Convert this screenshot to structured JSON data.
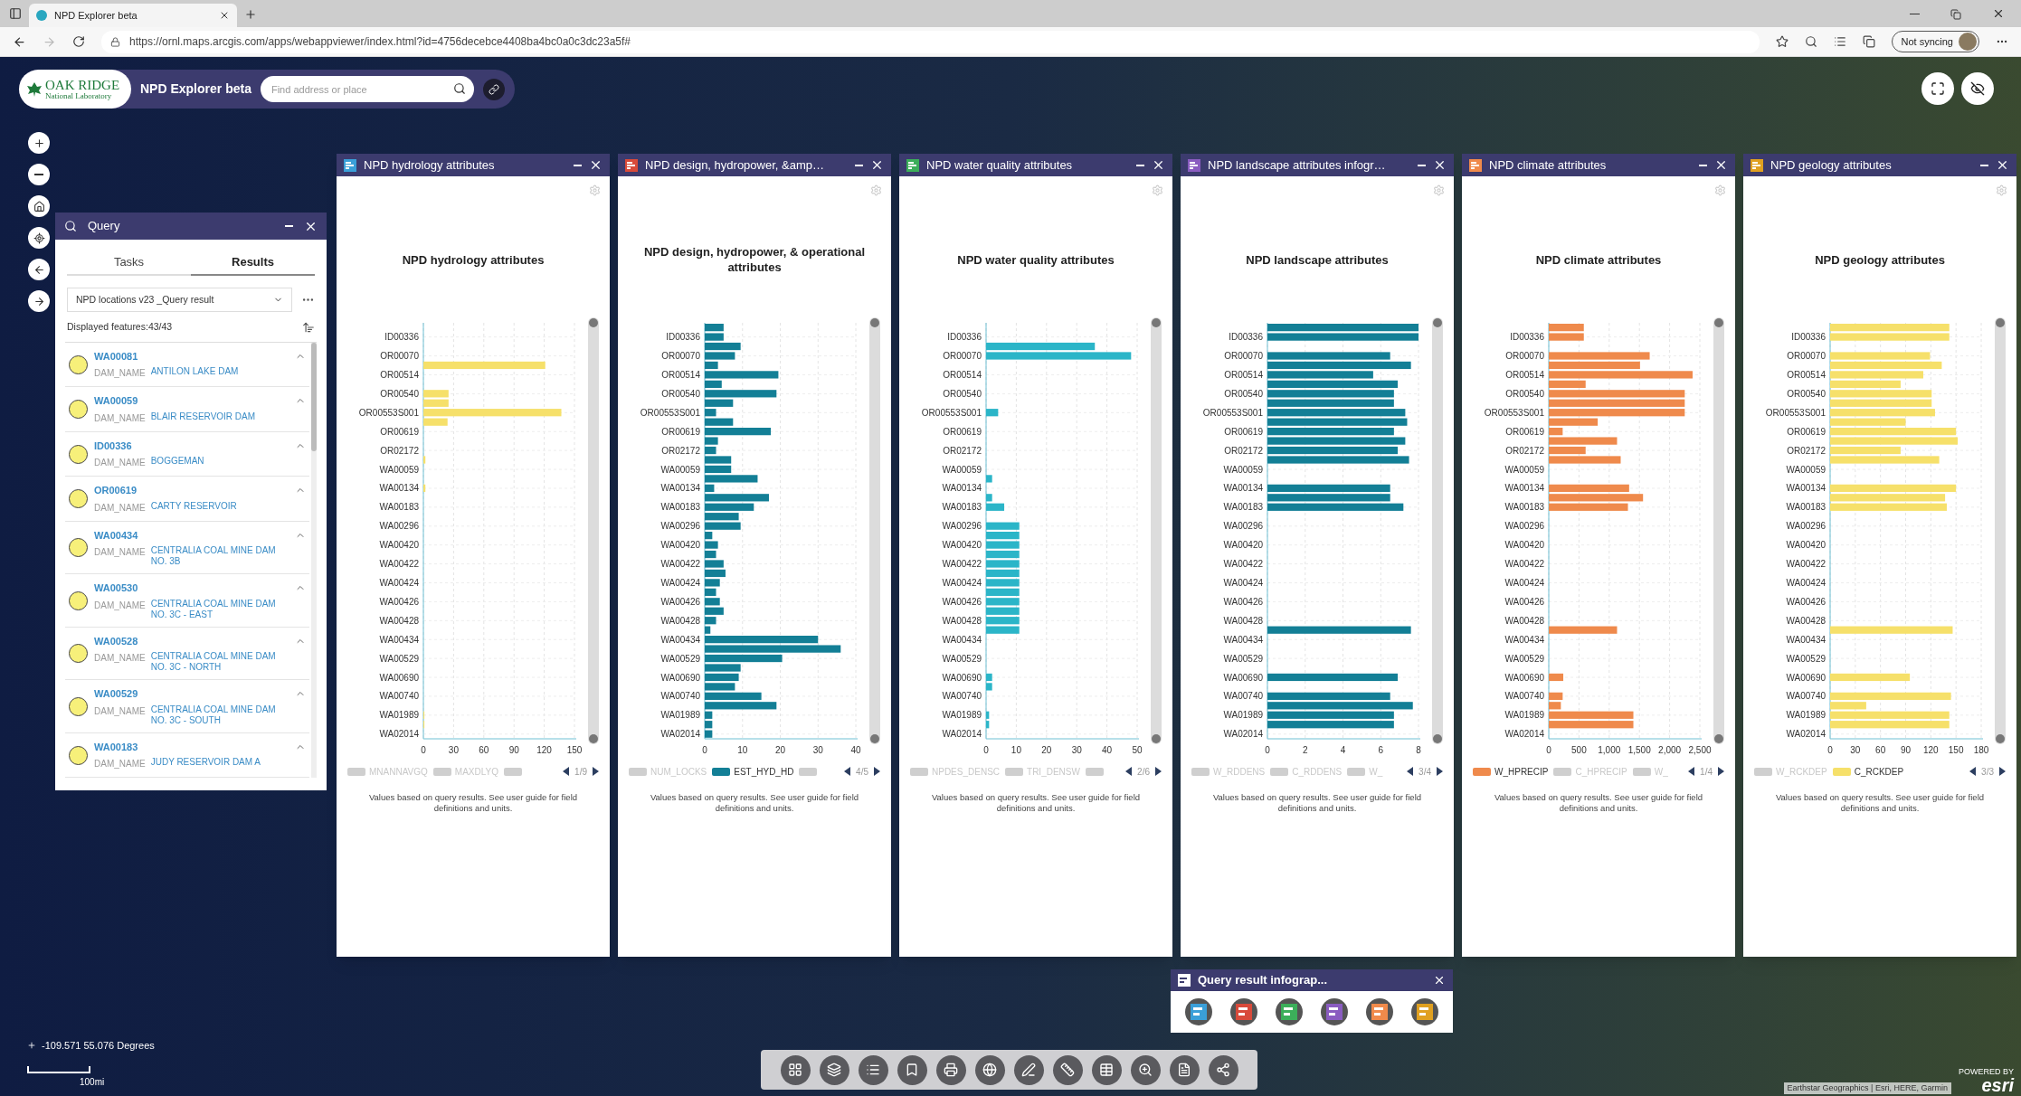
{
  "browser": {
    "tab_title": "NPD Explorer beta",
    "url": "https://ornl.maps.arcgis.com/apps/webappviewer/index.html?id=4756decebce4408ba4bc0a0c3dc23a5f#",
    "profile_label": "Not syncing"
  },
  "header": {
    "logo_line1": "OAK RIDGE",
    "logo_line2": "National Laboratory",
    "app_title": "NPD Explorer beta",
    "search_placeholder": "Find address or place"
  },
  "query": {
    "title": "Query",
    "tabs": [
      {
        "label": "Tasks",
        "selected": false
      },
      {
        "label": "Results",
        "selected": true
      }
    ],
    "layer": "NPD locations v23 _Query result",
    "count": "Displayed features:43/43",
    "results": [
      {
        "id": "WA00081",
        "field": "DAM_NAME",
        "value": "ANTILON LAKE DAM"
      },
      {
        "id": "WA00059",
        "field": "DAM_NAME",
        "value": "BLAIR RESERVOIR DAM"
      },
      {
        "id": "ID00336",
        "field": "DAM_NAME",
        "value": "BOGGEMAN"
      },
      {
        "id": "OR00619",
        "field": "DAM_NAME",
        "value": "CARTY RESERVOIR"
      },
      {
        "id": "WA00434",
        "field": "DAM_NAME",
        "value": "CENTRALIA COAL MINE DAM NO. 3B"
      },
      {
        "id": "WA00530",
        "field": "DAM_NAME",
        "value": "CENTRALIA COAL MINE DAM NO. 3C - EAST"
      },
      {
        "id": "WA00528",
        "field": "DAM_NAME",
        "value": "CENTRALIA COAL MINE DAM NO. 3C - NORTH"
      },
      {
        "id": "WA00529",
        "field": "DAM_NAME",
        "value": "CENTRALIA COAL MINE DAM NO. 3C - SOUTH"
      },
      {
        "id": "WA00183",
        "field": "DAM_NAME",
        "value": "JUDY RESERVOIR DAM A"
      }
    ]
  },
  "charts": [
    {
      "window_title": "NPD hydrology attributes",
      "color": "#3a9fd8",
      "legend": [
        {
          "label": "MNANNAVGQ",
          "on": false
        },
        {
          "label": "MAXDLYQ",
          "on": false
        },
        {
          "on": false
        }
      ],
      "page": "1/9",
      "note": "Values based on query results. See user guide for field definitions and units.",
      "chart_data": {
        "type": "bar",
        "orientation": "horizontal",
        "grid": true,
        "title": "NPD hydrology attributes",
        "xlim": [
          0,
          150
        ],
        "xticks": [
          0,
          30,
          60,
          90,
          120,
          150
        ],
        "categories": [
          null,
          "ID00336",
          null,
          "OR00070",
          null,
          "OR00514",
          null,
          "OR00540",
          null,
          "OR00553S001",
          null,
          "OR00619",
          null,
          "OR02172",
          null,
          "WA00059",
          null,
          "WA00134",
          null,
          "WA00183",
          null,
          "WA00296",
          null,
          "WA00420",
          null,
          "WA00422",
          null,
          "WA00424",
          null,
          "WA00426",
          null,
          "WA00428",
          null,
          "WA00434",
          null,
          "WA00529",
          null,
          "WA00690",
          null,
          "WA00740",
          null,
          "WA01989",
          null,
          "WA02014"
        ],
        "series": [
          {
            "color": "#f6e06a",
            "values": [
              null,
              null,
              null,
              null,
              121,
              null,
              null,
              25,
              25,
              137,
              24,
              null,
              null,
              null,
              2,
              null,
              null,
              2,
              null,
              null,
              null,
              null,
              null,
              null,
              null,
              null,
              null,
              null,
              null,
              null,
              null,
              null,
              null,
              null,
              null,
              null,
              null,
              null,
              null,
              null,
              null,
              1,
              1,
              null
            ]
          }
        ]
      }
    },
    {
      "window_title": "NPD design, hydropower, &amp…",
      "color": "#d84a3a",
      "legend": [
        {
          "label": "NUM_LOCKS",
          "on": false
        },
        {
          "label": "EST_HYD_HD",
          "on": true
        },
        {
          "on": false
        }
      ],
      "page": "4/5",
      "note": "Values based on query results. See user guide for field definitions and units.",
      "chart_data": {
        "type": "bar",
        "orientation": "horizontal",
        "grid": true,
        "title": "NPD design, hydropower, & operational attributes",
        "xlim": [
          0,
          40
        ],
        "xticks": [
          0,
          10,
          20,
          30,
          40
        ],
        "categories": [
          null,
          "ID00336",
          null,
          "OR00070",
          null,
          "OR00514",
          null,
          "OR00540",
          null,
          "OR00553S001",
          null,
          "OR00619",
          null,
          "OR02172",
          null,
          "WA00059",
          null,
          "WA00134",
          null,
          "WA00183",
          null,
          "WA00296",
          null,
          "WA00420",
          null,
          "WA00422",
          null,
          "WA00424",
          null,
          "WA00426",
          null,
          "WA00428",
          null,
          "WA00434",
          null,
          "WA00529",
          null,
          "WA00690",
          null,
          "WA00740",
          null,
          "WA01989",
          null,
          "WA02014"
        ],
        "series": [
          {
            "color": "#137f96",
            "values": [
              5,
              5,
              9.5,
              8,
              3.5,
              19.5,
              4.5,
              19,
              7.5,
              3,
              7.5,
              17.5,
              3.5,
              3,
              7,
              7,
              14,
              2.5,
              17,
              13,
              9,
              9.5,
              2,
              3.5,
              3,
              5,
              5.5,
              4,
              3,
              4,
              5,
              3,
              1.5,
              30,
              36,
              20.5,
              9.5,
              9,
              8,
              15,
              19,
              2,
              2,
              2
            ]
          }
        ]
      }
    },
    {
      "window_title": "NPD water quality attributes",
      "color": "#3cae5a",
      "legend": [
        {
          "label": "NPDES_DENSC",
          "on": false
        },
        {
          "label": "TRI_DENSW",
          "on": false
        },
        {
          "on": false
        }
      ],
      "page": "2/6",
      "note": "Values based on query results. See user guide for field definitions and units.",
      "chart_data": {
        "type": "bar",
        "orientation": "horizontal",
        "grid": true,
        "title": "NPD water quality attributes",
        "xlim": [
          0,
          50
        ],
        "xticks": [
          0,
          10,
          20,
          30,
          40,
          50
        ],
        "categories": [
          null,
          "ID00336",
          null,
          "OR00070",
          null,
          "OR00514",
          null,
          "OR00540",
          null,
          "OR00553S001",
          null,
          "OR00619",
          null,
          "OR02172",
          null,
          "WA00059",
          null,
          "WA00134",
          null,
          "WA00183",
          null,
          "WA00296",
          null,
          "WA00420",
          null,
          "WA00422",
          null,
          "WA00424",
          null,
          "WA00426",
          null,
          "WA00428",
          null,
          "WA00434",
          null,
          "WA00529",
          null,
          "WA00690",
          null,
          "WA00740",
          null,
          "WA01989",
          null,
          "WA02014"
        ],
        "series": [
          {
            "color": "#2bb5c8",
            "values": [
              null,
              null,
              36,
              48,
              null,
              null,
              null,
              null,
              null,
              4,
              null,
              null,
              null,
              null,
              null,
              null,
              2,
              null,
              2,
              6,
              null,
              11,
              11,
              11,
              11,
              11,
              11,
              11,
              11,
              11,
              11,
              11,
              11,
              null,
              null,
              null,
              null,
              2,
              2,
              null,
              null,
              1,
              1,
              null
            ]
          }
        ]
      }
    },
    {
      "window_title": "NPD landscape attributes infogr…",
      "color": "#8a5cc0",
      "legend": [
        {
          "label": "W_RDDENS",
          "on": false
        },
        {
          "label": "C_RDDENS",
          "on": false
        },
        {
          "label": "W_",
          "on": false
        }
      ],
      "page": "3/4",
      "note": "Values based on query results. See user guide for field definitions and units.",
      "chart_data": {
        "type": "bar",
        "orientation": "horizontal",
        "grid": true,
        "title": "NPD landscape attributes",
        "xlim": [
          0,
          8
        ],
        "xticks": [
          0,
          2,
          4,
          6,
          8
        ],
        "categories": [
          null,
          "ID00336",
          null,
          "OR00070",
          null,
          "OR00514",
          null,
          "OR00540",
          null,
          "OR00553S001",
          null,
          "OR00619",
          null,
          "OR02172",
          null,
          "WA00059",
          null,
          "WA00134",
          null,
          "WA00183",
          null,
          "WA00296",
          null,
          "WA00420",
          null,
          "WA00422",
          null,
          "WA00424",
          null,
          "WA00426",
          null,
          "WA00428",
          null,
          "WA00434",
          null,
          "WA00529",
          null,
          "WA00690",
          null,
          "WA00740",
          null,
          "WA01989",
          null,
          "WA02014"
        ],
        "series": [
          {
            "color": "#137f96",
            "values": [
              8,
              8,
              null,
              6.5,
              7.6,
              5.6,
              6.9,
              6.7,
              6.7,
              7.3,
              7.4,
              6.7,
              7.3,
              6.9,
              7.5,
              null,
              null,
              6.5,
              6.5,
              7.2,
              null,
              null,
              null,
              null,
              null,
              null,
              null,
              null,
              null,
              null,
              null,
              null,
              7.6,
              null,
              null,
              null,
              null,
              6.9,
              null,
              6.5,
              7.7,
              6.7,
              6.7,
              null
            ]
          }
        ]
      }
    },
    {
      "window_title": "NPD climate attributes",
      "color": "#f08a4b",
      "legend": [
        {
          "label": "W_HPRECIP",
          "on": true
        },
        {
          "label": "C_HPRECIP",
          "on": false
        },
        {
          "label": "W_",
          "on": false
        }
      ],
      "page": "1/4",
      "note": "Values based on query results. See user guide for field definitions and units.",
      "chart_data": {
        "type": "bar",
        "orientation": "horizontal",
        "grid": true,
        "title": "NPD climate attributes",
        "xlim": [
          0,
          2500
        ],
        "xticks": [
          0,
          500,
          {
            "value": 1000,
            "label": "1,000"
          },
          {
            "value": 1500,
            "label": "1,500"
          },
          {
            "value": 2000,
            "label": "2,000"
          },
          {
            "value": 2500,
            "label": "2,500"
          }
        ],
        "categories": [
          null,
          "ID00336",
          null,
          "OR00070",
          null,
          "OR00514",
          null,
          "OR00540",
          null,
          "OR00553S001",
          null,
          "OR00619",
          null,
          "OR02172",
          null,
          "WA00059",
          null,
          "WA00134",
          null,
          "WA00183",
          null,
          "WA00296",
          null,
          "WA00420",
          null,
          "WA00422",
          null,
          "WA00424",
          null,
          "WA00426",
          null,
          "WA00428",
          null,
          "WA00434",
          null,
          "WA00529",
          null,
          "WA00690",
          null,
          "WA00740",
          null,
          "WA01989",
          null,
          "WA02014"
        ],
        "series": [
          {
            "color": "#ef8a4c",
            "values": [
              580,
              580,
              null,
              1670,
              1510,
              2380,
              610,
              2250,
              2250,
              2250,
              810,
              230,
              1130,
              610,
              1190,
              null,
              null,
              1330,
              1560,
              1310,
              null,
              null,
              null,
              null,
              null,
              null,
              null,
              null,
              null,
              null,
              null,
              null,
              1130,
              null,
              null,
              null,
              null,
              240,
              null,
              230,
              200,
              1400,
              1400,
              null
            ]
          }
        ]
      }
    },
    {
      "window_title": "NPD geology attributes",
      "color": "#e0a020",
      "legend": [
        {
          "label": "W_RCKDEP",
          "on": false
        },
        {
          "label": "C_RCKDEP",
          "on": true
        }
      ],
      "page": "3/3",
      "note": "Values based on query results. See user guide for field definitions and units.",
      "chart_data": {
        "type": "bar",
        "orientation": "horizontal",
        "grid": true,
        "title": "NPD geology attributes",
        "xlim": [
          0,
          180
        ],
        "xticks": [
          0,
          30,
          60,
          90,
          120,
          150,
          180
        ],
        "categories": [
          null,
          "ID00336",
          null,
          "OR00070",
          null,
          "OR00514",
          null,
          "OR00540",
          null,
          "OR00553S001",
          null,
          "OR00619",
          null,
          "OR02172",
          null,
          "WA00059",
          null,
          "WA00134",
          null,
          "WA00183",
          null,
          "WA00296",
          null,
          "WA00420",
          null,
          "WA00422",
          null,
          "WA00424",
          null,
          "WA00426",
          null,
          "WA00428",
          null,
          "WA00434",
          null,
          "WA00529",
          null,
          "WA00690",
          null,
          "WA00740",
          null,
          "WA01989",
          null,
          "WA02014"
        ],
        "series": [
          {
            "color": "#f6e06a",
            "values": [
              142,
              142,
              null,
              119,
              133,
              111,
              84,
              121,
              121,
              125,
              90,
              150,
              152,
              84,
              130,
              null,
              null,
              150,
              137,
              139,
              null,
              null,
              null,
              null,
              null,
              null,
              null,
              null,
              null,
              null,
              null,
              null,
              146,
              null,
              null,
              null,
              null,
              95,
              null,
              144,
              43,
              142,
              142,
              null
            ]
          }
        ]
      }
    }
  ],
  "infographic": {
    "title": "Query result infograp...",
    "items": [
      {
        "color": "#3a9fd8"
      },
      {
        "color": "#d84a3a"
      },
      {
        "color": "#3cae5a"
      },
      {
        "color": "#8a5cc0"
      },
      {
        "color": "#f08a4b"
      },
      {
        "color": "#e0a020"
      }
    ]
  },
  "status": {
    "coordinates": "-109.571 55.076 Degrees",
    "scale": "100mi"
  },
  "attribution": "Earthstar Geographics | Esri, HERE, Garmin",
  "esri": {
    "powered_by": "POWERED BY",
    "logo": "esri"
  }
}
